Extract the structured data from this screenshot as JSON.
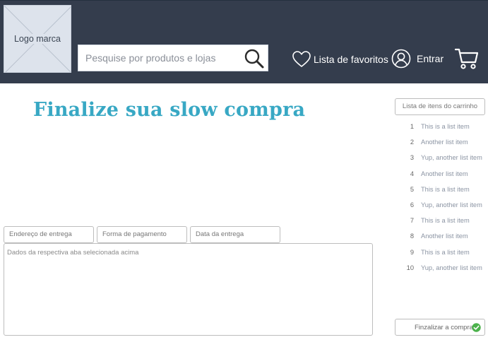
{
  "header": {
    "logo_text": "Logo marca",
    "search": {
      "placeholder": "Pesquise por produtos e lojas",
      "value": ""
    },
    "favorites_label": "Lista de favoritos",
    "login_label": "Entrar",
    "icons": {
      "search": "search-icon",
      "favorites": "heart-icon",
      "login": "user-icon",
      "cart": "cart-icon"
    }
  },
  "main": {
    "title": "Finalize sua slow compra",
    "tabs": [
      {
        "label": "Endereço de entrega"
      },
      {
        "label": "Forma de pagamento"
      },
      {
        "label": "Data da entrega"
      }
    ],
    "panel_text": "Dados da respectiva aba selecionada acima"
  },
  "cart": {
    "header": "Lista de itens do carrinho",
    "items": [
      {
        "num": "1",
        "label": "This is a list item"
      },
      {
        "num": "2",
        "label": "Another list item"
      },
      {
        "num": "3",
        "label": "Yup, another list item"
      },
      {
        "num": "4",
        "label": "Another list item"
      },
      {
        "num": "5",
        "label": "This is a list item"
      },
      {
        "num": "6",
        "label": "Yup, another list item"
      },
      {
        "num": "7",
        "label": "This is a list item"
      },
      {
        "num": "8",
        "label": "Another list item"
      },
      {
        "num": "9",
        "label": "This is a list item"
      },
      {
        "num": "10",
        "label": "Yup, another list item"
      }
    ],
    "checkout_label": "Finzalizar a compra",
    "checkout_icon": "check-circle-icon"
  },
  "colors": {
    "header_bg": "#343d4d",
    "title": "#38a8c4",
    "check": "#4cb24c"
  }
}
